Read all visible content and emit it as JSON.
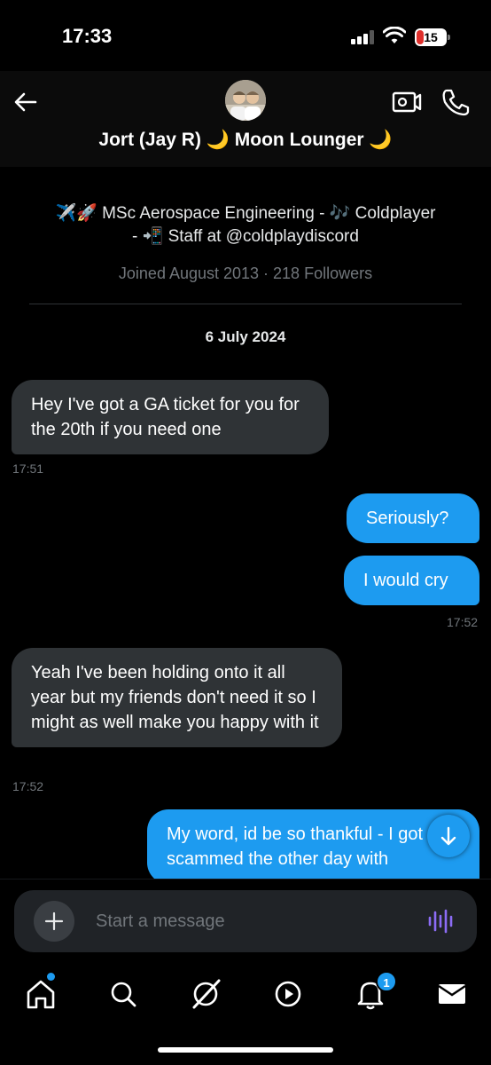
{
  "status_bar": {
    "time": "17:33",
    "battery": "15",
    "battery_color": "#e0302c"
  },
  "header": {
    "contact_name": "Jort (Jay R) 🌙 Moon Lounger 🌙",
    "back_icon": "arrow-left-icon",
    "video_icon": "video-icon",
    "call_icon": "phone-icon"
  },
  "profile": {
    "bio_line1": "✈️🚀 MSc Aerospace Engineering - 🎶 Coldplayer",
    "bio_line2": "- 📲 Staff at @coldplaydiscord",
    "joined": "Joined August 2013 · 218 Followers"
  },
  "conversation": {
    "date": "6 July 2024",
    "messages": [
      {
        "direction": "in",
        "text": "Hey I've got a GA ticket for you for the 20th if you need one",
        "time": "17:51"
      },
      {
        "direction": "out",
        "text": "Seriously?",
        "time": ""
      },
      {
        "direction": "out",
        "text": "I would cry",
        "time": "17:52"
      },
      {
        "direction": "in",
        "text": "Yeah I've been holding onto it all year but my friends don't need it so I might as well make you happy with it",
        "time": "17:52"
      },
      {
        "direction": "out",
        "text": "My word, id be so thankful - I got scammed the other day with",
        "time": ""
      }
    ]
  },
  "composer": {
    "placeholder": "Start a message",
    "add_icon": "plus-icon",
    "voice_icon": "voice-wave-icon"
  },
  "tab_bar": {
    "tabs": [
      "home-icon",
      "search-icon",
      "grok-icon",
      "video-play-icon",
      "bell-icon",
      "mail-icon"
    ],
    "notification_count": "1"
  },
  "colors": {
    "accent": "#1d9bf0",
    "incoming_bubble": "#2f3336",
    "background": "#000000"
  }
}
